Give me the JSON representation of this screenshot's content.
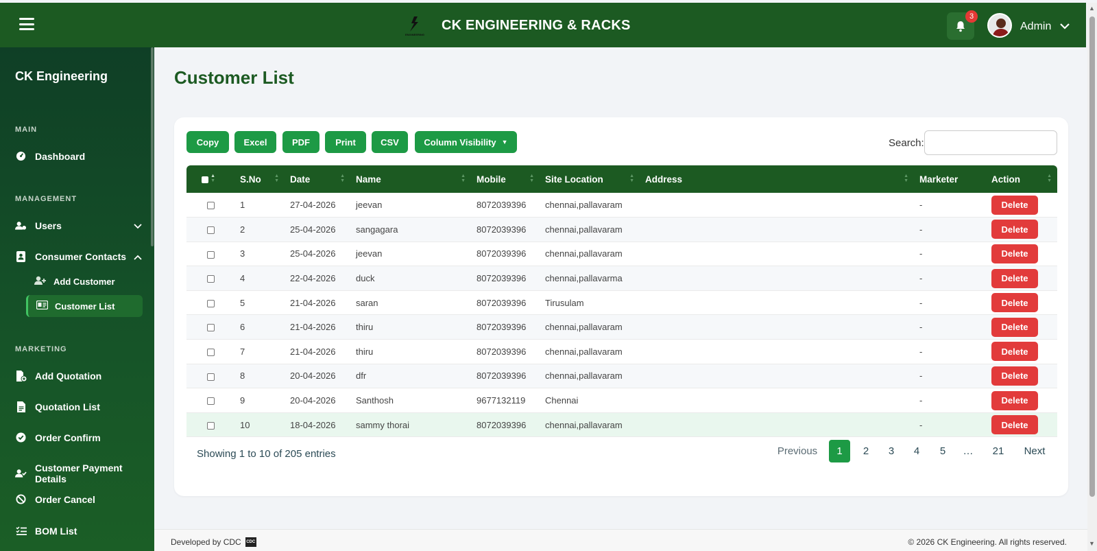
{
  "header": {
    "brand_title": "CK ENGINEERING & RACKS",
    "logo_caption": "ENGINEERING",
    "notification_count": "3",
    "user_name": "Admin"
  },
  "sidebar": {
    "brand": "CK Engineering",
    "sections": {
      "main": "MAIN",
      "management": "MANAGEMENT",
      "marketing": "MARKETING"
    },
    "items": {
      "dashboard": "Dashboard",
      "users": "Users",
      "consumer_contacts": "Consumer Contacts",
      "add_customer": "Add Customer",
      "customer_list": "Customer List",
      "add_quotation": "Add Quotation",
      "quotation_list": "Quotation List",
      "order_confirm": "Order Confirm",
      "customer_payment": "Customer Payment Details",
      "order_cancel": "Order Cancel",
      "bom_list": "BOM List"
    }
  },
  "page": {
    "title": "Customer List"
  },
  "toolbar": {
    "copy": "Copy",
    "excel": "Excel",
    "pdf": "PDF",
    "print": "Print",
    "csv": "CSV",
    "column_visibility": "Column Visibility",
    "search_label": "Search:",
    "search_value": ""
  },
  "table": {
    "headers": [
      "S.No",
      "Date",
      "Name",
      "Mobile",
      "Site Location",
      "Address",
      "Marketer",
      "Action"
    ],
    "delete_label": "Delete",
    "rows": [
      {
        "sno": "1",
        "date": "27-04-2026",
        "name": "jeevan",
        "mobile": "8072039396",
        "site": "chennai,pallavaram",
        "address": "",
        "marketer": "-"
      },
      {
        "sno": "2",
        "date": "25-04-2026",
        "name": "sangagara",
        "mobile": "8072039396",
        "site": "chennai,pallavaram",
        "address": "",
        "marketer": "-"
      },
      {
        "sno": "3",
        "date": "25-04-2026",
        "name": "jeevan",
        "mobile": "8072039396",
        "site": "chennai,pallavaram",
        "address": "",
        "marketer": "-"
      },
      {
        "sno": "4",
        "date": "22-04-2026",
        "name": "duck",
        "mobile": "8072039396",
        "site": "chennai,pallavarma",
        "address": "",
        "marketer": "-"
      },
      {
        "sno": "5",
        "date": "21-04-2026",
        "name": "saran",
        "mobile": "8072039396",
        "site": "Tirusulam",
        "address": "",
        "marketer": "-"
      },
      {
        "sno": "6",
        "date": "21-04-2026",
        "name": "thiru",
        "mobile": "8072039396",
        "site": "chennai,pallavaram",
        "address": "",
        "marketer": "-"
      },
      {
        "sno": "7",
        "date": "21-04-2026",
        "name": "thiru",
        "mobile": "8072039396",
        "site": "chennai,pallavaram",
        "address": "",
        "marketer": "-"
      },
      {
        "sno": "8",
        "date": "20-04-2026",
        "name": "dfr",
        "mobile": "8072039396",
        "site": "chennai,pallavaram",
        "address": "",
        "marketer": "-"
      },
      {
        "sno": "9",
        "date": "20-04-2026",
        "name": "Santhosh",
        "mobile": "9677132119",
        "site": "Chennai",
        "address": "",
        "marketer": "-"
      },
      {
        "sno": "10",
        "date": "18-04-2026",
        "name": "sammy thorai",
        "mobile": "8072039396",
        "site": "chennai,pallavaram",
        "address": "",
        "marketer": "-"
      }
    ]
  },
  "pagination": {
    "info": "Showing 1 to 10 of 205 entries",
    "previous": "Previous",
    "pages": [
      "1",
      "2",
      "3",
      "4",
      "5",
      "…",
      "21"
    ],
    "next": "Next"
  },
  "footer": {
    "developed_by": "Developed by CDC",
    "cdc_logo": "CDC",
    "copyright": "© 2026 CK Engineering. All rights reserved."
  },
  "colors": {
    "primary": "#1c5a22",
    "button": "#1d9a45",
    "danger": "#e23b3b"
  }
}
